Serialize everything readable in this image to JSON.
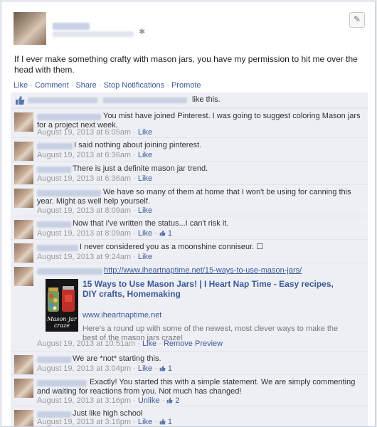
{
  "post": {
    "edit_icon": "pencil-icon",
    "gear_icon": "gear-icon",
    "status_text": "If I ever make something crafty with mason jars, you have my permission to hit me over the head with them."
  },
  "actions": {
    "like": "Like",
    "comment": "Comment",
    "share": "Share",
    "stop_notifications": "Stop Notifications",
    "promote": "Promote",
    "sep": " · "
  },
  "likes": {
    "text": "like this.",
    "icon": "thumbs-up-icon"
  },
  "comments": [
    {
      "text": "You mist have joined Pinterest. I was going to suggest coloring Mason jars for a project next week.",
      "timestamp": "August 19, 2013 at 6:05am",
      "action": "Like"
    },
    {
      "text": "I said nothing about joining pinterest.",
      "timestamp": "August 19, 2013 at 6:36am",
      "action": "Like"
    },
    {
      "text": "There is just a definite mason jar trend.",
      "timestamp": "August 19, 2013 at 6:36am",
      "action": "Like"
    },
    {
      "text": "We have so many of them at home that I won't be using for canning this year. Might as well help yourself.",
      "timestamp": "August 19, 2013 at 8:09am",
      "action": "Like"
    },
    {
      "text": "Now that I've written the status...I can't risk it.",
      "timestamp": "August 19, 2013 at 8:09am",
      "action": "Like",
      "like_count": "1"
    },
    {
      "text": "I never considered you as a moonshine conniseur. ☐",
      "timestamp": "August 19, 2013 at 9:24am",
      "action": "Like"
    },
    {
      "link": "http://www.iheartnaptime.net/15-ways-to-use-mason-jars/",
      "share_title": "15 Ways to Use Mason Jars! | I Heart Nap Time - Easy recipes, DIY crafts, Homemaking",
      "share_url": "www.iheartnaptime.net",
      "share_desc": "Here's a round up with some of the newest, most clever ways to make the best of the mason jars craze!",
      "share_image_text": "Mason Jar craze",
      "timestamp": "August 19, 2013 at 10:51am",
      "action": "Like",
      "remove_preview": "Remove Preview"
    },
    {
      "text": "We are *not* starting this.",
      "timestamp": "August 19, 2013 at 3:04pm",
      "action": "Like",
      "like_count": "1"
    },
    {
      "text": "Exactly! You started this with a simple statement. We are simply commenting and waiting for reactions from you. Not much has changed!",
      "timestamp": "August 19, 2013 at 3:16pm",
      "action": "Unlike",
      "like_count": "2"
    },
    {
      "text": "Just like high school",
      "timestamp": "August 19, 2013 at 3:16pm",
      "action": "Like",
      "like_count": "1"
    }
  ],
  "colors": {
    "link": "#3b5998",
    "ufi_bg": "#edeff4",
    "border": "#c4cde0"
  }
}
